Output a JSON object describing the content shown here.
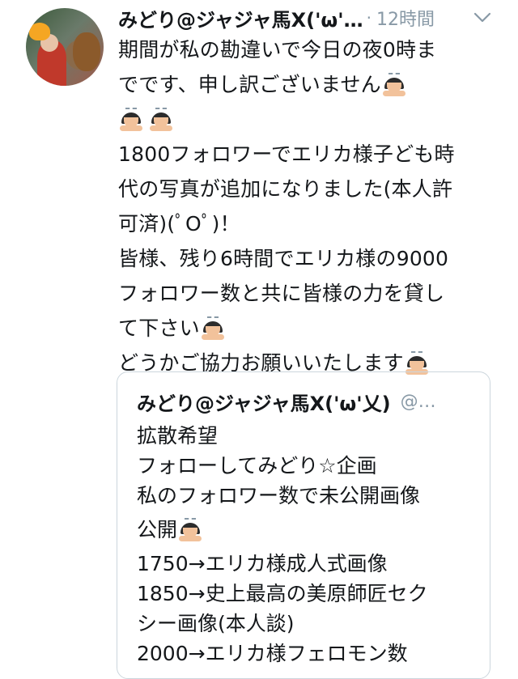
{
  "tweet": {
    "author_name": "みどり@ジャジャ馬X('ω'…",
    "separator": "·",
    "time": "12時間",
    "lines": [
      "期間が私の勘違いで今日の夜0時ま",
      "でです、申し訳ございません",
      "",
      "1800フォロワーでエリカ様子ども時",
      "代の写真が追加になりました(本人許",
      "可済)(ﾟOﾟ)！",
      "皆様、残り6時間でエリカ様の9000",
      "フォロワー数と共に皆様の力を貸し",
      "て下さい",
      "どうかご協力お願いいたします"
    ]
  },
  "quoted_tweet": {
    "author_name": "みどり@ジャジャ馬X('ω'乂)",
    "handle": "@…",
    "lines": [
      "拡散希望",
      "フォローしてみどり☆企画",
      "私のフォロワー数で未公開画像",
      "公開",
      "1750→エリカ様成人式画像",
      "1850→史上最高の美原師匠セク",
      "シー画像(本人談)",
      "2000→エリカ様フェロモン数"
    ]
  },
  "icons": {
    "avatar": "avatar-photo",
    "caret": "chevron-down-icon",
    "emoji": "person-bowing-emoji"
  },
  "colors": {
    "text": "#14171a",
    "secondary": "#8899a6",
    "border": "#ccd6dd"
  }
}
